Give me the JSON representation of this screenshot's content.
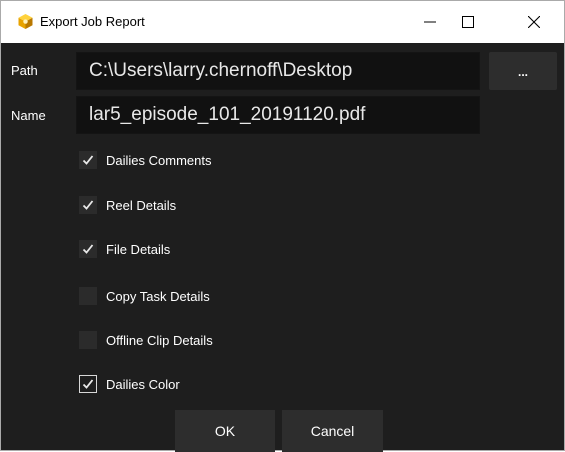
{
  "window": {
    "title": "Export Job Report",
    "icon": "cube-icon",
    "controls": [
      "minimize-icon",
      "maximize-icon",
      "close-icon"
    ]
  },
  "form": {
    "path_label": "Path",
    "path_value": "C:\\Users\\larry.chernoff\\Desktop",
    "browse_label": "...",
    "name_label": "Name",
    "name_value": "lar5_episode_101_20191120.pdf"
  },
  "options": [
    {
      "label": "Dailies Comments",
      "checked": true
    },
    {
      "label": "Reel Details",
      "checked": true
    },
    {
      "label": "File Details",
      "checked": true
    },
    {
      "label": "Copy Task Details",
      "checked": false
    },
    {
      "label": "Offline Clip Details",
      "checked": false
    },
    {
      "label": "Dailies Color",
      "checked": true
    }
  ],
  "buttons": {
    "ok_label": "OK",
    "cancel_label": "Cancel"
  },
  "colors": {
    "background": "#1e1e1e",
    "field": "#111111",
    "button": "#2d2d2d",
    "icon_accent": "#f0b400"
  }
}
